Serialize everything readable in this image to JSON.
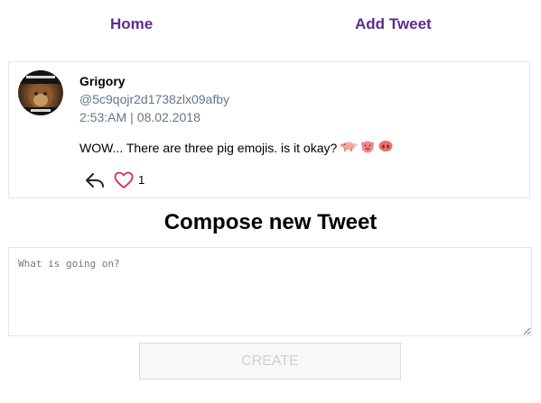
{
  "nav": {
    "home_label": "Home",
    "add_tweet_label": "Add Tweet"
  },
  "tweet": {
    "author": "Grigory",
    "handle": "@5c9qojr2d1738zlx09afby",
    "time": "2:53:AM",
    "separator": "|",
    "date": "08.02.2018",
    "text": "WOW... There are three pig emojis. is it okay?",
    "emojis": [
      "pig-icon",
      "pig-face-icon",
      "pig-nose-icon"
    ],
    "like_count": "1",
    "colors": {
      "like": "#e0245e",
      "meta": "#657786"
    }
  },
  "compose": {
    "title": "Compose new Tweet",
    "placeholder": "What is going on?",
    "value": "",
    "create_label": "CREATE"
  },
  "theme": {
    "nav_link_color": "#5b2d8e",
    "border_color": "#e6e6e6"
  }
}
